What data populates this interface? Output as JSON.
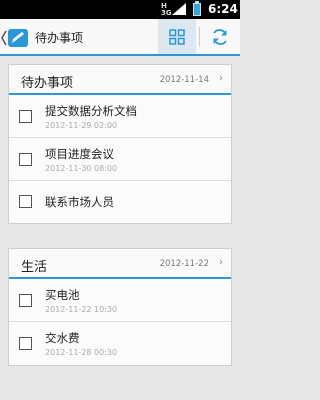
{
  "status_bar": {
    "network": [
      "H",
      "3G"
    ],
    "time": "6:24"
  },
  "action_bar": {
    "title": "待办事项",
    "icons": {
      "back": "back-chevron-icon",
      "app": "pencil-app-icon",
      "grid": "grid-icon",
      "refresh": "refresh-icon"
    },
    "accent_color": "#2c97d6"
  },
  "groups": [
    {
      "title": "待办事项",
      "date": "2012-11-14",
      "chevron": "›",
      "items": [
        {
          "title": "提交数据分析文档",
          "date": "2012-11-29 02:00"
        },
        {
          "title": "项目进度会议",
          "date": "2012-11-30 08:00"
        },
        {
          "title": "联系市场人员",
          "date": ""
        }
      ]
    },
    {
      "title": "生活",
      "date": "2012-11-22",
      "chevron": "›",
      "items": [
        {
          "title": "买电池",
          "date": "2012-11-22 10:30"
        },
        {
          "title": "交水费",
          "date": "2012-11-28 00:30"
        }
      ]
    }
  ]
}
